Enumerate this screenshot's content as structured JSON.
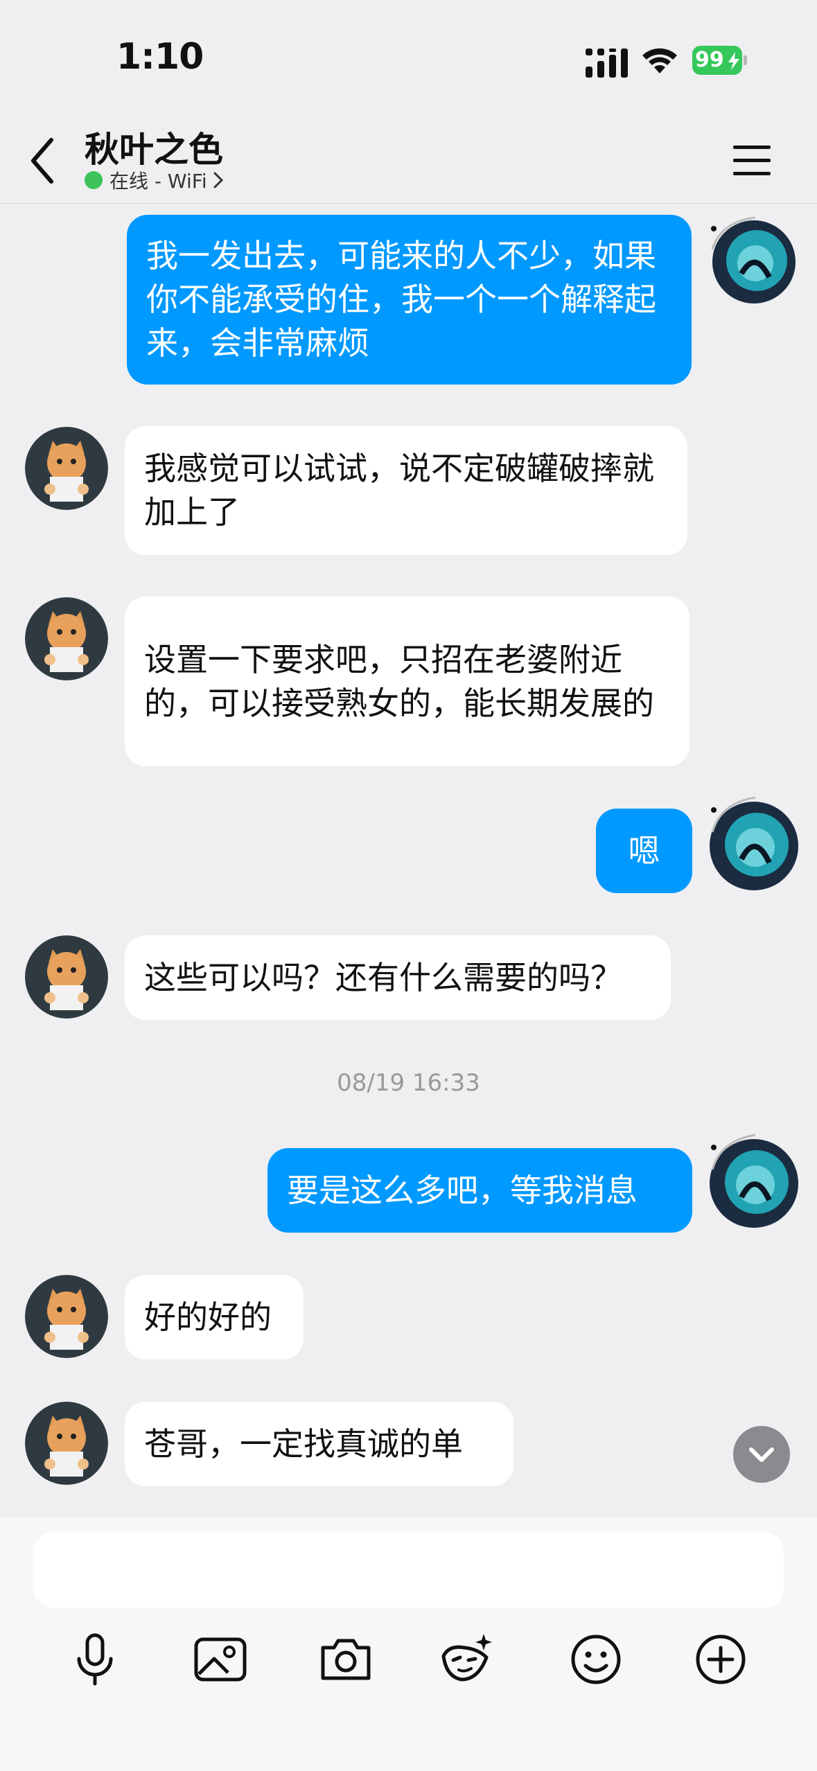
{
  "status_bar": {
    "time": "1:10",
    "battery": "99"
  },
  "header": {
    "title": "秋叶之色",
    "presence": "在线 - WiFi"
  },
  "messages": [
    {
      "side": "self",
      "text": "我一发出去，可能来的人不少，如果你不能承受的住，我一个一个解释起来，会非常麻烦"
    },
    {
      "side": "other",
      "text": "我感觉可以试试，说不定破罐破摔就加上了"
    },
    {
      "side": "other",
      "text": "设置一下要求吧，只招在老婆附近的，可以接受熟女的，能长期发展的"
    },
    {
      "side": "self",
      "text": "嗯"
    },
    {
      "side": "other",
      "text": "这些可以吗？还有什么需要的吗？"
    },
    {
      "side": "timestamp",
      "text": "08/19 16:33"
    },
    {
      "side": "self",
      "text": "要是这么多吧，等我消息"
    },
    {
      "side": "other",
      "text": "好的好的"
    },
    {
      "side": "other",
      "text": "苍哥，一定找真诚的单"
    }
  ],
  "composer": {
    "value": "",
    "placeholder": ""
  },
  "toolbar": [
    "microphone-icon",
    "image-icon",
    "camera-icon",
    "sticker-icon",
    "emoji-icon",
    "plus-icon"
  ],
  "colors": {
    "self_bubble": "#0099ff",
    "other_bubble": "#ffffff",
    "online": "#3ec35b",
    "battery": "#35c759"
  }
}
